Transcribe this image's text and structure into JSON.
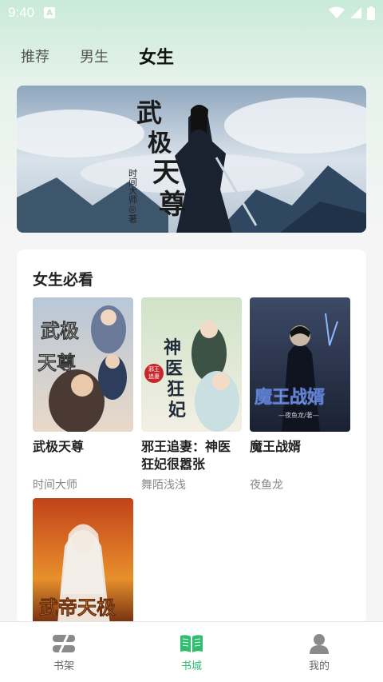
{
  "status_bar": {
    "time": "9:40",
    "notification_glyph": "A"
  },
  "top_tabs": [
    {
      "label": "推荐",
      "active": false
    },
    {
      "label": "男生",
      "active": false
    },
    {
      "label": "女生",
      "active": true
    }
  ],
  "banner": {
    "title_art": "武极天尊",
    "author_art": "时间大师◎著"
  },
  "section": {
    "title": "女生必看",
    "books": [
      {
        "title": "武极天尊",
        "author": "时间大师",
        "cover_text": "武极天尊"
      },
      {
        "title": "邪王追妻：神医狂妃很嚣张",
        "author": "舞陌浅浅",
        "cover_text": "神医狂妃"
      },
      {
        "title": "魔王战婿",
        "author": "夜鱼龙",
        "cover_text": "魔王战婿"
      },
      {
        "title": "",
        "author": "",
        "cover_text": "武帝天极"
      }
    ]
  },
  "bottom_nav": [
    {
      "label": "书架",
      "icon": "bookshelf-icon",
      "active": false
    },
    {
      "label": "书城",
      "icon": "book-open-icon",
      "active": true
    },
    {
      "label": "我的",
      "icon": "user-icon",
      "active": false
    }
  ],
  "colors": {
    "accent": "#2fbf6f",
    "header_gradient_top": "#c9ead8"
  }
}
